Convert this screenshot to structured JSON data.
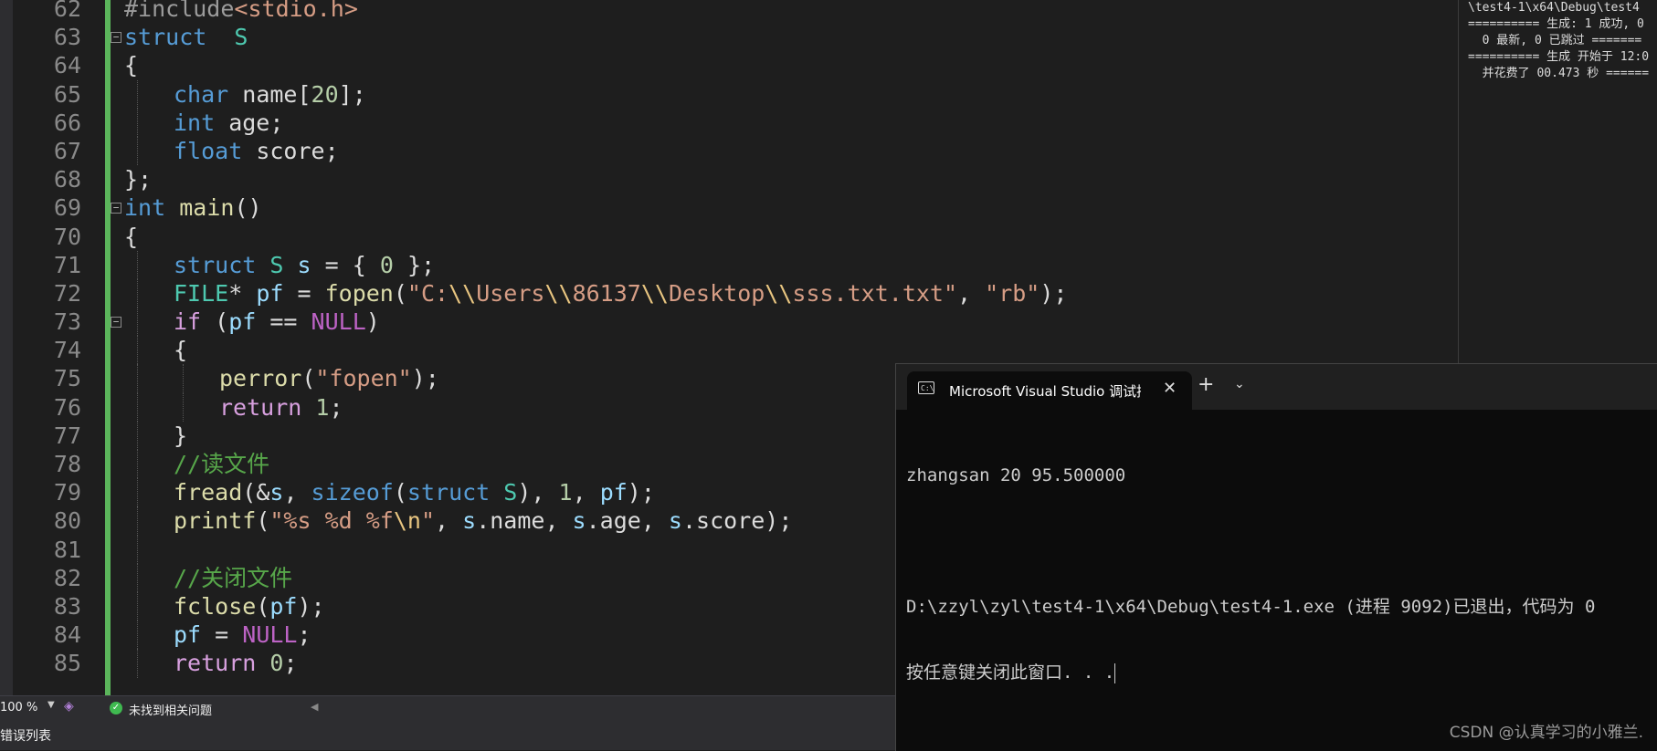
{
  "editor": {
    "lines": [
      {
        "n": "62",
        "indent": 0,
        "fold": "",
        "tokens": [
          [
            "pre",
            "#include"
          ],
          [
            "str",
            "<stdio.h>"
          ]
        ]
      },
      {
        "n": "63",
        "indent": 0,
        "fold": "−",
        "tokens": [
          [
            "kw",
            "struct"
          ],
          [
            "",
            "  "
          ],
          [
            "ty",
            "S"
          ]
        ]
      },
      {
        "n": "64",
        "indent": 0,
        "fold": "",
        "tokens": [
          [
            "",
            "{"
          ]
        ]
      },
      {
        "n": "65",
        "indent": 1,
        "fold": "",
        "tokens": [
          [
            "kw",
            "char"
          ],
          [
            "",
            " name["
          ],
          [
            "num",
            "20"
          ],
          [
            "",
            "];"
          ]
        ]
      },
      {
        "n": "66",
        "indent": 1,
        "fold": "",
        "tokens": [
          [
            "kw",
            "int"
          ],
          [
            "",
            " age;"
          ]
        ]
      },
      {
        "n": "67",
        "indent": 1,
        "fold": "",
        "tokens": [
          [
            "kw",
            "float"
          ],
          [
            "",
            " score;"
          ]
        ]
      },
      {
        "n": "68",
        "indent": 0,
        "fold": "",
        "tokens": [
          [
            "",
            "};"
          ]
        ]
      },
      {
        "n": "69",
        "indent": 0,
        "fold": "−",
        "tokens": [
          [
            "kw",
            "int"
          ],
          [
            "",
            " "
          ],
          [
            "fn",
            "main"
          ],
          [
            "",
            "()"
          ]
        ]
      },
      {
        "n": "70",
        "indent": 0,
        "fold": "",
        "tokens": [
          [
            "",
            "{"
          ]
        ]
      },
      {
        "n": "71",
        "indent": 1,
        "fold": "",
        "tokens": [
          [
            "kw",
            "struct"
          ],
          [
            "",
            " "
          ],
          [
            "ty",
            "S"
          ],
          [
            "",
            " "
          ],
          [
            "var",
            "s"
          ],
          [
            "",
            " = { "
          ],
          [
            "num",
            "0"
          ],
          [
            "",
            " };"
          ]
        ]
      },
      {
        "n": "72",
        "indent": 1,
        "fold": "",
        "tokens": [
          [
            "ty",
            "FILE"
          ],
          [
            "",
            "* "
          ],
          [
            "var",
            "pf"
          ],
          [
            "",
            " = "
          ],
          [
            "fn",
            "fopen"
          ],
          [
            "",
            "("
          ],
          [
            "str",
            "\"C:"
          ],
          [
            "esc",
            "\\\\"
          ],
          [
            "str",
            "Users"
          ],
          [
            "esc",
            "\\\\"
          ],
          [
            "str",
            "86137"
          ],
          [
            "esc",
            "\\\\"
          ],
          [
            "str",
            "Desktop"
          ],
          [
            "esc",
            "\\\\"
          ],
          [
            "str",
            "sss.txt.txt\""
          ],
          [
            "",
            ", "
          ],
          [
            "str",
            "\"rb\""
          ],
          [
            "",
            ");"
          ]
        ]
      },
      {
        "n": "73",
        "indent": 1,
        "fold": "−",
        "tokens": [
          [
            "kw2",
            "if"
          ],
          [
            "",
            " ("
          ],
          [
            "var",
            "pf"
          ],
          [
            "",
            " == "
          ],
          [
            "mac",
            "NULL"
          ],
          [
            "",
            ")"
          ]
        ]
      },
      {
        "n": "74",
        "indent": 1,
        "fold": "",
        "tokens": [
          [
            "",
            "{"
          ]
        ]
      },
      {
        "n": "75",
        "indent": 2,
        "fold": "",
        "tokens": [
          [
            "fn",
            "perror"
          ],
          [
            "",
            "("
          ],
          [
            "str",
            "\"fopen\""
          ],
          [
            "",
            ");"
          ]
        ]
      },
      {
        "n": "76",
        "indent": 2,
        "fold": "",
        "tokens": [
          [
            "kw2",
            "return"
          ],
          [
            "",
            " "
          ],
          [
            "num",
            "1"
          ],
          [
            "",
            ";"
          ]
        ]
      },
      {
        "n": "77",
        "indent": 1,
        "fold": "",
        "tokens": [
          [
            "",
            "}"
          ]
        ]
      },
      {
        "n": "78",
        "indent": 1,
        "fold": "",
        "tokens": [
          [
            "cm",
            "//读文件"
          ]
        ]
      },
      {
        "n": "79",
        "indent": 1,
        "fold": "",
        "tokens": [
          [
            "fn",
            "fread"
          ],
          [
            "",
            "(&"
          ],
          [
            "var",
            "s"
          ],
          [
            "",
            ", "
          ],
          [
            "kw",
            "sizeof"
          ],
          [
            "",
            "("
          ],
          [
            "kw",
            "struct"
          ],
          [
            "",
            " "
          ],
          [
            "ty",
            "S"
          ],
          [
            "",
            "), "
          ],
          [
            "num",
            "1"
          ],
          [
            "",
            ", "
          ],
          [
            "var",
            "pf"
          ],
          [
            "",
            ");"
          ]
        ]
      },
      {
        "n": "80",
        "indent": 1,
        "fold": "",
        "tokens": [
          [
            "fn",
            "printf"
          ],
          [
            "",
            "("
          ],
          [
            "str",
            "\"%s %d %f"
          ],
          [
            "esc",
            "\\n"
          ],
          [
            "str",
            "\""
          ],
          [
            "",
            ", "
          ],
          [
            "var",
            "s"
          ],
          [
            "",
            ".name, "
          ],
          [
            "var",
            "s"
          ],
          [
            "",
            ".age, "
          ],
          [
            "var",
            "s"
          ],
          [
            "",
            ".score);"
          ]
        ]
      },
      {
        "n": "81",
        "indent": 1,
        "fold": "",
        "tokens": []
      },
      {
        "n": "82",
        "indent": 1,
        "fold": "",
        "tokens": [
          [
            "cm",
            "//关闭文件"
          ]
        ]
      },
      {
        "n": "83",
        "indent": 1,
        "fold": "",
        "tokens": [
          [
            "fn",
            "fclose"
          ],
          [
            "",
            "("
          ],
          [
            "var",
            "pf"
          ],
          [
            "",
            ");"
          ]
        ]
      },
      {
        "n": "84",
        "indent": 1,
        "fold": "",
        "tokens": [
          [
            "var",
            "pf"
          ],
          [
            "",
            " = "
          ],
          [
            "mac",
            "NULL"
          ],
          [
            "",
            ";"
          ]
        ]
      },
      {
        "n": "85",
        "indent": 1,
        "fold": "",
        "tokens": [
          [
            "kw2",
            "return"
          ],
          [
            "",
            " "
          ],
          [
            "num",
            "0"
          ],
          [
            "",
            ";"
          ]
        ]
      }
    ]
  },
  "output_pane": {
    "lines": [
      "\\test4-1\\x64\\Debug\\test4",
      "========== 生成: 1 成功, 0",
      "  0 最新, 0 已跳过 =======",
      "========== 生成 开始于 12:0",
      "  并花费了 00.473 秒 ======"
    ]
  },
  "status_bar": {
    "zoom": "100 %",
    "issues_text": "未找到相关问题"
  },
  "bottom_bar": {
    "error_list_label": "错误列表"
  },
  "console": {
    "tab_title": "Microsoft Visual Studio 调试控制台",
    "lines": [
      "zhangsan 20 95.500000",
      "",
      "D:\\zzyl\\zyl\\test4-1\\x64\\Debug\\test4-1.exe (进程 9092)已退出，代码为 0",
      "按任意键关闭此窗口. . ."
    ],
    "watermark": "CSDN @认真学习的小雅兰."
  },
  "colors": {
    "editor_bg": "#1e1e1e",
    "change_bar": "#5bb55b",
    "console_bg": "#0c0c0c"
  }
}
